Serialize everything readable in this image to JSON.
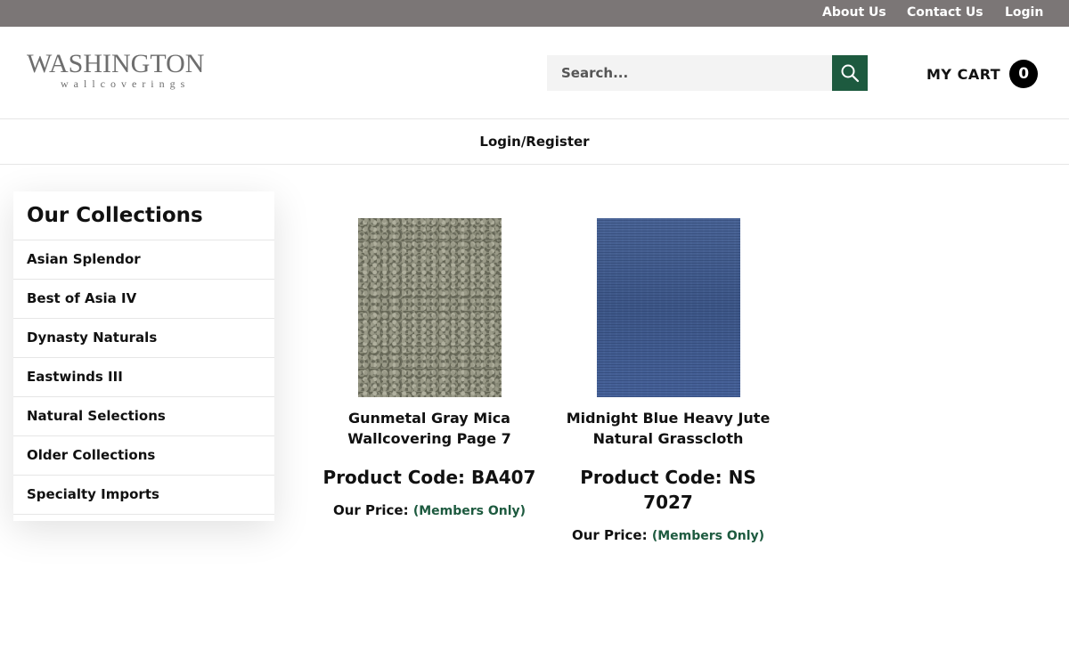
{
  "topbar": {
    "about": "About Us",
    "contact": "Contact Us",
    "login": "Login"
  },
  "header": {
    "logo_main": "WASHINGTON",
    "logo_sub": "wallcoverings",
    "search_placeholder": "Search...",
    "cart_label": "MY CART",
    "cart_count": "0"
  },
  "nav": {
    "login_register": "Login/Register"
  },
  "sidebar": {
    "title": "Our Collections",
    "items": [
      "Asian Splendor",
      "Best of Asia IV",
      "Dynasty Naturals",
      "Eastwinds III",
      "Natural Selections",
      "Older Collections",
      "Specialty Imports"
    ]
  },
  "products": [
    {
      "name": "Gunmetal Gray Mica Wallcovering Page 7",
      "code": "Product Code: BA407",
      "price_label": "Our Price:",
      "price_value": "(Members Only)"
    },
    {
      "name": "Midnight Blue Heavy Jute Natural Grasscloth",
      "code": "Product Code: NS 7027",
      "price_label": "Our Price:",
      "price_value": "(Members Only)"
    }
  ],
  "colors": {
    "topbar": "#7b7676",
    "accent_green": "#1d5a3f",
    "badge": "#000000"
  },
  "icons": {
    "search": "search-icon"
  }
}
